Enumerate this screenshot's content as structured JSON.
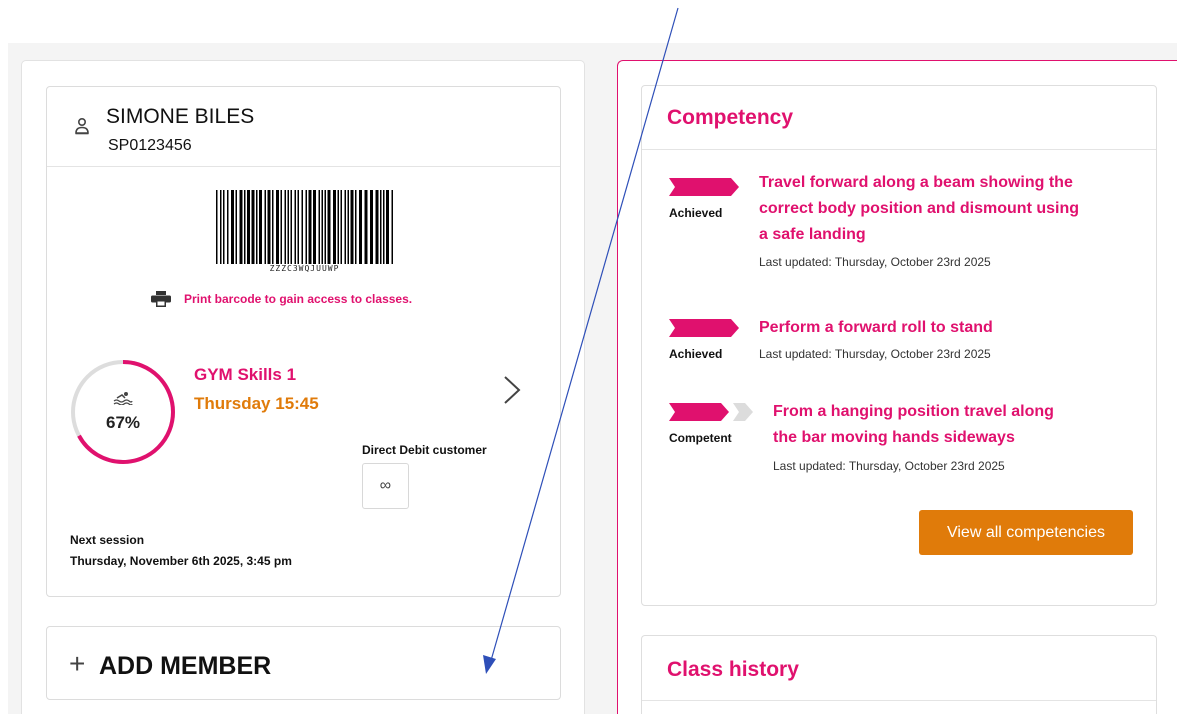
{
  "member": {
    "name": "SIMONE BILES",
    "id": "SP0123456",
    "barcode_text": "ZZZC3WQJUUWP",
    "print_text": "Print barcode to gain access to classes.",
    "progress_value": 67,
    "progress_label": "67%",
    "class_name": "GYM Skills 1",
    "class_time": "Thursday 15:45",
    "direct_debit_label": "Direct Debit customer",
    "direct_debit_symbol": "∞",
    "next_session_label": "Next session",
    "next_session_value": "Thursday, November 6th 2025, 3:45 pm"
  },
  "add_member": {
    "plus": "+",
    "label": "ADD MEMBER"
  },
  "competency": {
    "title": "Competency",
    "items": [
      {
        "status": "Achieved",
        "level": 2,
        "lines": [
          "Travel forward along a beam showing the",
          "correct body position and dismount using",
          "a safe landing"
        ],
        "updated": "Last updated: Thursday, October 23rd 2025"
      },
      {
        "status": "Achieved",
        "level": 2,
        "lines": [
          "Perform a forward roll to stand"
        ],
        "updated": "Last updated: Thursday, October 23rd 2025"
      },
      {
        "status": "Competent",
        "level": 1,
        "lines": [
          "From a hanging position travel along",
          "the bar moving hands sideways"
        ],
        "updated": "Last updated: Thursday, October 23rd 2025"
      }
    ],
    "view_all_label": "View all competencies"
  },
  "class_history": {
    "title": "Class history"
  },
  "colors": {
    "brand_pink": "#e0116e",
    "accent_orange": "#e07b0a",
    "annotation_blue": "#2e4fb8"
  },
  "icons": {
    "user": "user-icon",
    "printer": "printer-icon",
    "swim": "swim-icon",
    "chevron": "chevron-right-icon",
    "infinity": "infinity-icon"
  }
}
